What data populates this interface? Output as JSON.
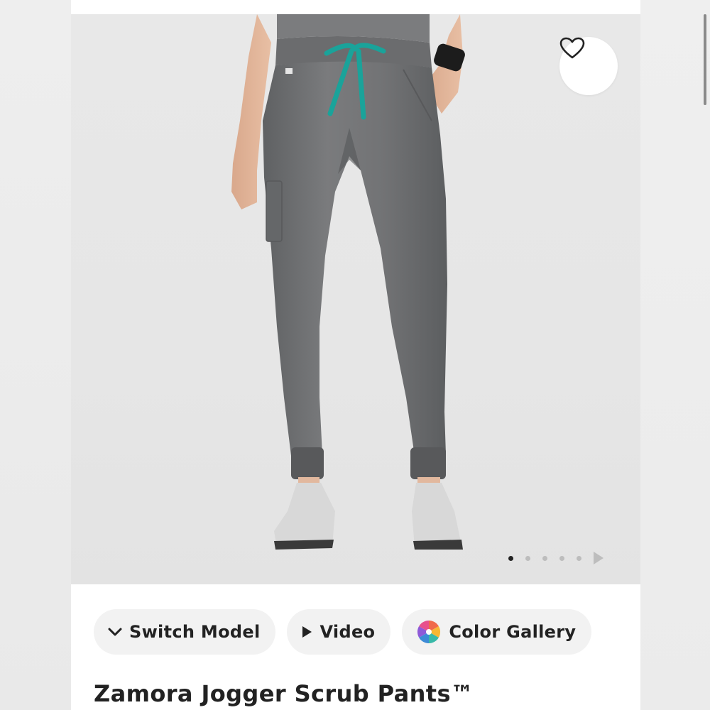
{
  "product": {
    "title": "Zamora Jogger Scrub Pants™"
  },
  "gallery": {
    "total_images": 5,
    "active_index": 0,
    "favorite_icon": "heart-outline-icon",
    "next_icon": "play-triangle-icon"
  },
  "actions": {
    "switch_model": {
      "label": "Switch Model",
      "icon": "chevron-down-icon"
    },
    "video": {
      "label": "Video",
      "icon": "play-icon"
    },
    "color_gallery": {
      "label": "Color Gallery",
      "icon": "color-wheel-icon"
    }
  },
  "colors": {
    "pants": "#6f7072",
    "drawstring": "#1aa39a",
    "accent_text": "#222222"
  }
}
